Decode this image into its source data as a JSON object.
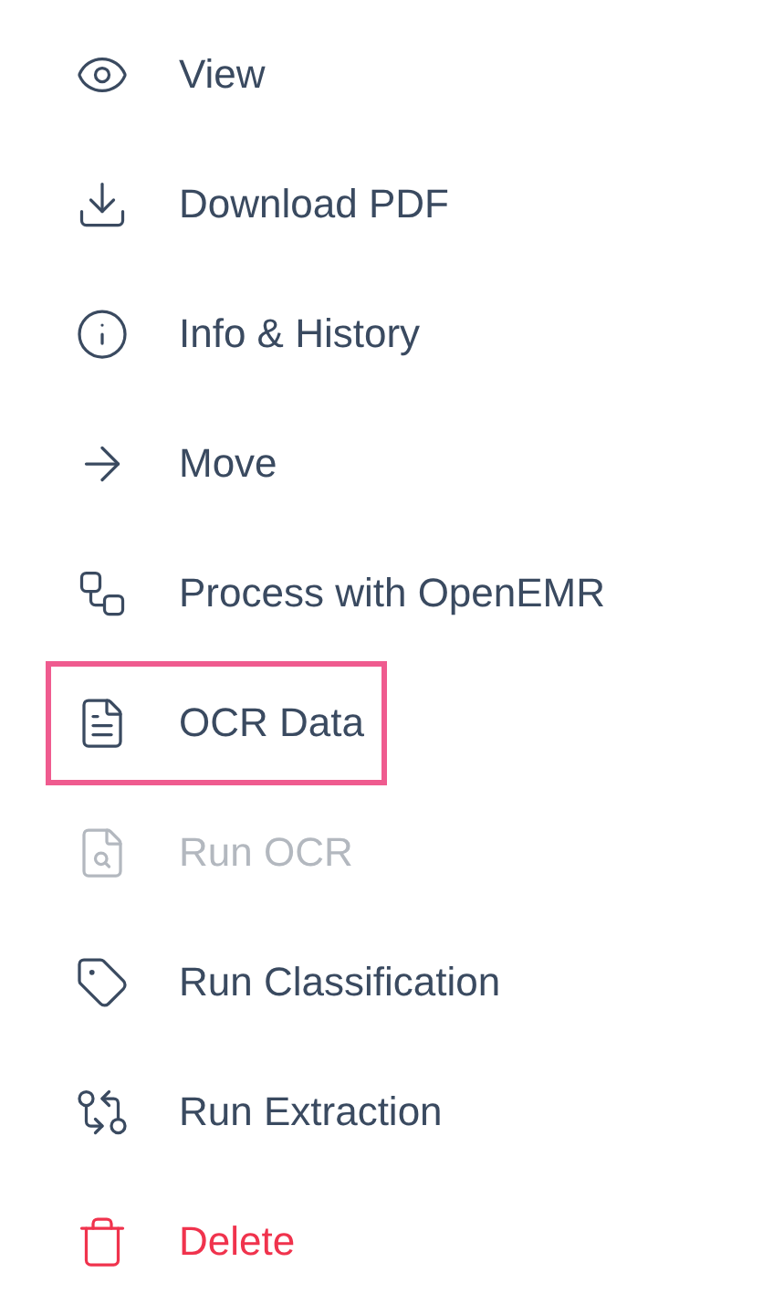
{
  "menu": {
    "items": [
      {
        "label": "View",
        "kind": "normal",
        "disabled": false,
        "selected": false
      },
      {
        "label": "Download PDF",
        "kind": "normal",
        "disabled": false,
        "selected": false
      },
      {
        "label": "Info & History",
        "kind": "normal",
        "disabled": false,
        "selected": false
      },
      {
        "label": "Move",
        "kind": "normal",
        "disabled": false,
        "selected": false
      },
      {
        "label": "Process with OpenEMR",
        "kind": "normal",
        "disabled": false,
        "selected": false
      },
      {
        "label": "OCR Data",
        "kind": "normal",
        "disabled": false,
        "selected": true
      },
      {
        "label": "Run OCR",
        "kind": "normal",
        "disabled": true,
        "selected": false
      },
      {
        "label": "Run Classification",
        "kind": "normal",
        "disabled": false,
        "selected": false
      },
      {
        "label": "Run Extraction",
        "kind": "normal",
        "disabled": false,
        "selected": false
      },
      {
        "label": "Delete",
        "kind": "danger",
        "disabled": false,
        "selected": false
      }
    ]
  }
}
